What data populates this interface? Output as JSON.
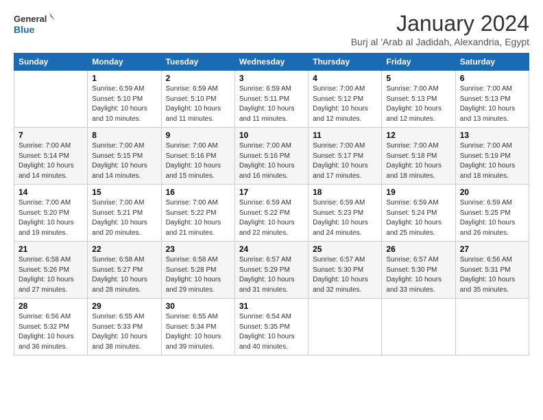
{
  "logo": {
    "text_general": "General",
    "text_blue": "Blue"
  },
  "header": {
    "month_year": "January 2024",
    "location": "Burj al 'Arab al Jadidah, Alexandria, Egypt"
  },
  "weekdays": [
    "Sunday",
    "Monday",
    "Tuesday",
    "Wednesday",
    "Thursday",
    "Friday",
    "Saturday"
  ],
  "weeks": [
    [
      {
        "day": "",
        "sunrise": "",
        "sunset": "",
        "daylight": ""
      },
      {
        "day": "1",
        "sunrise": "Sunrise: 6:59 AM",
        "sunset": "Sunset: 5:10 PM",
        "daylight": "Daylight: 10 hours and 10 minutes."
      },
      {
        "day": "2",
        "sunrise": "Sunrise: 6:59 AM",
        "sunset": "Sunset: 5:10 PM",
        "daylight": "Daylight: 10 hours and 11 minutes."
      },
      {
        "day": "3",
        "sunrise": "Sunrise: 6:59 AM",
        "sunset": "Sunset: 5:11 PM",
        "daylight": "Daylight: 10 hours and 11 minutes."
      },
      {
        "day": "4",
        "sunrise": "Sunrise: 7:00 AM",
        "sunset": "Sunset: 5:12 PM",
        "daylight": "Daylight: 10 hours and 12 minutes."
      },
      {
        "day": "5",
        "sunrise": "Sunrise: 7:00 AM",
        "sunset": "Sunset: 5:13 PM",
        "daylight": "Daylight: 10 hours and 12 minutes."
      },
      {
        "day": "6",
        "sunrise": "Sunrise: 7:00 AM",
        "sunset": "Sunset: 5:13 PM",
        "daylight": "Daylight: 10 hours and 13 minutes."
      }
    ],
    [
      {
        "day": "7",
        "sunrise": "Sunrise: 7:00 AM",
        "sunset": "Sunset: 5:14 PM",
        "daylight": "Daylight: 10 hours and 14 minutes."
      },
      {
        "day": "8",
        "sunrise": "Sunrise: 7:00 AM",
        "sunset": "Sunset: 5:15 PM",
        "daylight": "Daylight: 10 hours and 14 minutes."
      },
      {
        "day": "9",
        "sunrise": "Sunrise: 7:00 AM",
        "sunset": "Sunset: 5:16 PM",
        "daylight": "Daylight: 10 hours and 15 minutes."
      },
      {
        "day": "10",
        "sunrise": "Sunrise: 7:00 AM",
        "sunset": "Sunset: 5:16 PM",
        "daylight": "Daylight: 10 hours and 16 minutes."
      },
      {
        "day": "11",
        "sunrise": "Sunrise: 7:00 AM",
        "sunset": "Sunset: 5:17 PM",
        "daylight": "Daylight: 10 hours and 17 minutes."
      },
      {
        "day": "12",
        "sunrise": "Sunrise: 7:00 AM",
        "sunset": "Sunset: 5:18 PM",
        "daylight": "Daylight: 10 hours and 18 minutes."
      },
      {
        "day": "13",
        "sunrise": "Sunrise: 7:00 AM",
        "sunset": "Sunset: 5:19 PM",
        "daylight": "Daylight: 10 hours and 18 minutes."
      }
    ],
    [
      {
        "day": "14",
        "sunrise": "Sunrise: 7:00 AM",
        "sunset": "Sunset: 5:20 PM",
        "daylight": "Daylight: 10 hours and 19 minutes."
      },
      {
        "day": "15",
        "sunrise": "Sunrise: 7:00 AM",
        "sunset": "Sunset: 5:21 PM",
        "daylight": "Daylight: 10 hours and 20 minutes."
      },
      {
        "day": "16",
        "sunrise": "Sunrise: 7:00 AM",
        "sunset": "Sunset: 5:22 PM",
        "daylight": "Daylight: 10 hours and 21 minutes."
      },
      {
        "day": "17",
        "sunrise": "Sunrise: 6:59 AM",
        "sunset": "Sunset: 5:22 PM",
        "daylight": "Daylight: 10 hours and 22 minutes."
      },
      {
        "day": "18",
        "sunrise": "Sunrise: 6:59 AM",
        "sunset": "Sunset: 5:23 PM",
        "daylight": "Daylight: 10 hours and 24 minutes."
      },
      {
        "day": "19",
        "sunrise": "Sunrise: 6:59 AM",
        "sunset": "Sunset: 5:24 PM",
        "daylight": "Daylight: 10 hours and 25 minutes."
      },
      {
        "day": "20",
        "sunrise": "Sunrise: 6:59 AM",
        "sunset": "Sunset: 5:25 PM",
        "daylight": "Daylight: 10 hours and 26 minutes."
      }
    ],
    [
      {
        "day": "21",
        "sunrise": "Sunrise: 6:58 AM",
        "sunset": "Sunset: 5:26 PM",
        "daylight": "Daylight: 10 hours and 27 minutes."
      },
      {
        "day": "22",
        "sunrise": "Sunrise: 6:58 AM",
        "sunset": "Sunset: 5:27 PM",
        "daylight": "Daylight: 10 hours and 28 minutes."
      },
      {
        "day": "23",
        "sunrise": "Sunrise: 6:58 AM",
        "sunset": "Sunset: 5:28 PM",
        "daylight": "Daylight: 10 hours and 29 minutes."
      },
      {
        "day": "24",
        "sunrise": "Sunrise: 6:57 AM",
        "sunset": "Sunset: 5:29 PM",
        "daylight": "Daylight: 10 hours and 31 minutes."
      },
      {
        "day": "25",
        "sunrise": "Sunrise: 6:57 AM",
        "sunset": "Sunset: 5:30 PM",
        "daylight": "Daylight: 10 hours and 32 minutes."
      },
      {
        "day": "26",
        "sunrise": "Sunrise: 6:57 AM",
        "sunset": "Sunset: 5:30 PM",
        "daylight": "Daylight: 10 hours and 33 minutes."
      },
      {
        "day": "27",
        "sunrise": "Sunrise: 6:56 AM",
        "sunset": "Sunset: 5:31 PM",
        "daylight": "Daylight: 10 hours and 35 minutes."
      }
    ],
    [
      {
        "day": "28",
        "sunrise": "Sunrise: 6:56 AM",
        "sunset": "Sunset: 5:32 PM",
        "daylight": "Daylight: 10 hours and 36 minutes."
      },
      {
        "day": "29",
        "sunrise": "Sunrise: 6:55 AM",
        "sunset": "Sunset: 5:33 PM",
        "daylight": "Daylight: 10 hours and 38 minutes."
      },
      {
        "day": "30",
        "sunrise": "Sunrise: 6:55 AM",
        "sunset": "Sunset: 5:34 PM",
        "daylight": "Daylight: 10 hours and 39 minutes."
      },
      {
        "day": "31",
        "sunrise": "Sunrise: 6:54 AM",
        "sunset": "Sunset: 5:35 PM",
        "daylight": "Daylight: 10 hours and 40 minutes."
      },
      {
        "day": "",
        "sunrise": "",
        "sunset": "",
        "daylight": ""
      },
      {
        "day": "",
        "sunrise": "",
        "sunset": "",
        "daylight": ""
      },
      {
        "day": "",
        "sunrise": "",
        "sunset": "",
        "daylight": ""
      }
    ]
  ]
}
